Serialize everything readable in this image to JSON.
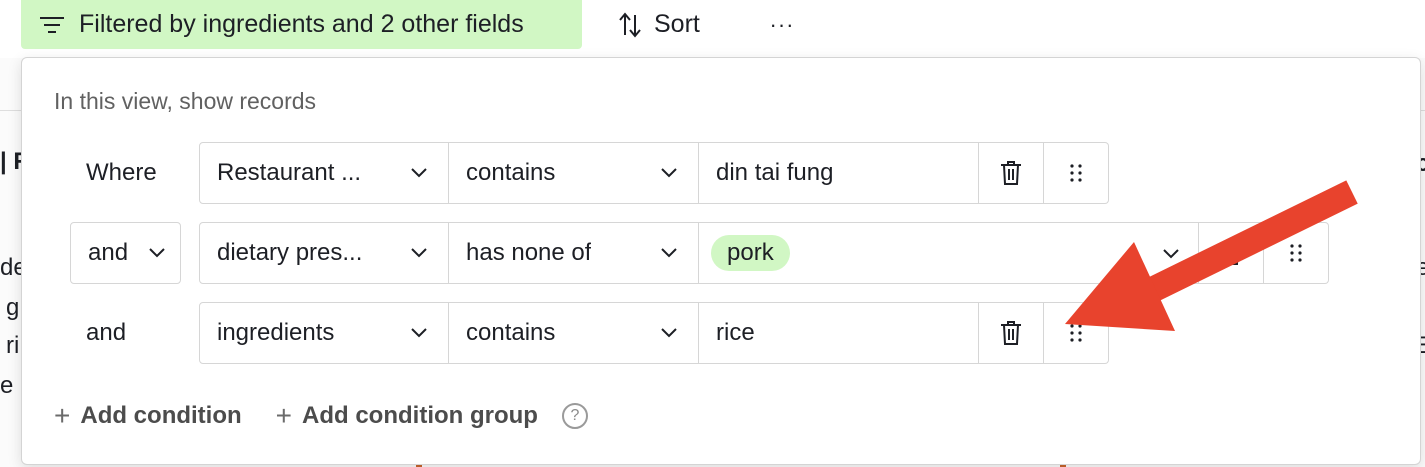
{
  "toolbar": {
    "filter_label": "Filtered by ingredients and 2 other fields",
    "sort_label": "Sort",
    "more_label": "···"
  },
  "background": {
    "left_fragments": [
      "| R",
      "de",
      "g",
      "ri",
      "e"
    ],
    "right_fragments": [
      "c",
      "e",
      "E"
    ]
  },
  "popover": {
    "title": "In this view, show records",
    "conditions": [
      {
        "conjunction": "Where",
        "field": "Restaurant ...",
        "operator": "contains",
        "value": "din tai fung"
      },
      {
        "conjunction": "and",
        "field": "dietary pres...",
        "operator": "has none of",
        "value_pill": "pork"
      },
      {
        "conjunction": "and",
        "field": "ingredients",
        "operator": "contains",
        "value": "rice"
      }
    ],
    "add_condition_label": "Add condition",
    "add_condition_group_label": "Add condition group",
    "help_label": "?"
  },
  "colors": {
    "filter_active_bg": "#d1f7c4",
    "pill_bg": "#d1f7c4",
    "annotation_arrow": "#e8432d"
  },
  "icons": {
    "filter": "filter-lines-icon",
    "sort": "sort-arrows-icon",
    "more": "more-dots-icon",
    "delete": "trash-icon",
    "drag": "drag-handle-icon",
    "dropdown": "chevron-down-icon",
    "add": "plus-icon",
    "help": "question-circle-icon"
  }
}
